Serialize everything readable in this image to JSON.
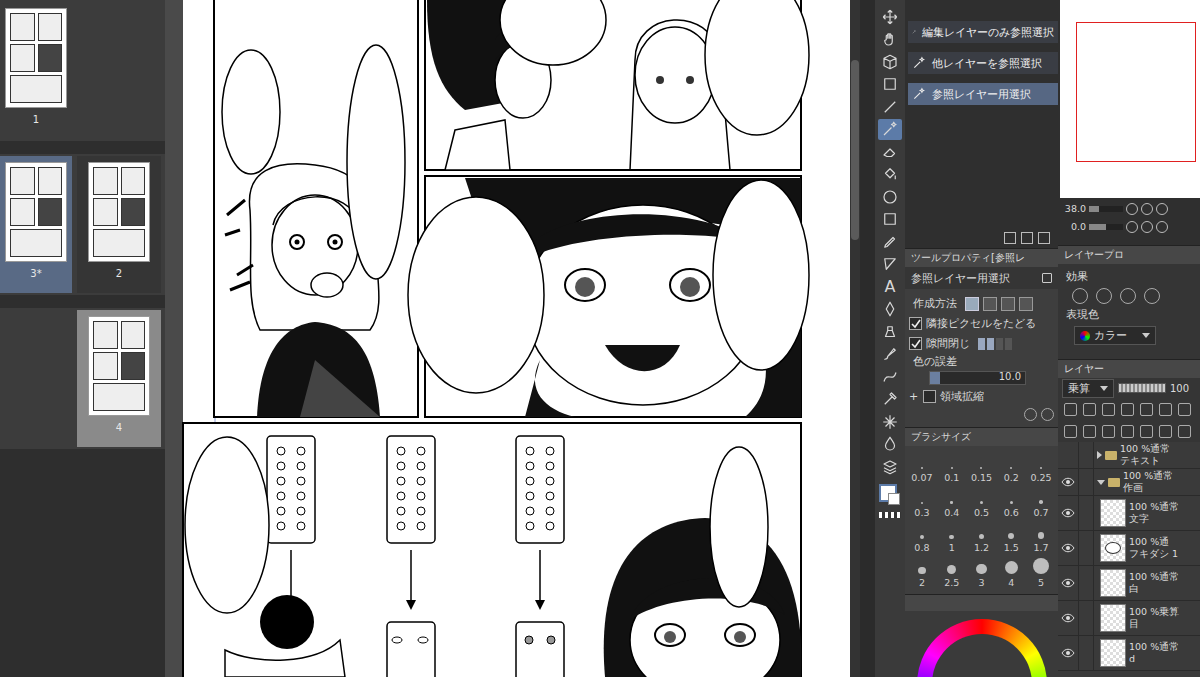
{
  "spreads": [
    {
      "pages": [
        {
          "label": "1",
          "slot": "left",
          "selected": false,
          "highlighted": false
        }
      ]
    },
    {
      "pages": [
        {
          "label": "3*",
          "slot": "left",
          "selected": true,
          "highlighted": false
        },
        {
          "label": "2",
          "slot": "right",
          "selected": false,
          "highlighted": false
        }
      ]
    },
    {
      "pages": [
        {
          "label": "4",
          "slot": "right",
          "selected": false,
          "highlighted": true
        }
      ]
    }
  ],
  "toolbar": [
    {
      "selected": false
    },
    {
      "selected": false
    },
    {
      "selected": false
    },
    {
      "selected": false
    },
    {
      "selected": false
    },
    {
      "selected": true
    },
    {
      "selected": false
    },
    {
      "selected": false
    },
    {
      "selected": false
    },
    {
      "selected": false
    },
    {
      "selected": false
    },
    {
      "selected": false
    },
    {
      "selected": false,
      "glyph": "A"
    },
    {
      "selected": false
    },
    {
      "selected": false
    },
    {
      "selected": false
    },
    {
      "selected": false
    },
    {
      "selected": false
    },
    {
      "selected": false
    },
    {
      "selected": false
    },
    {
      "selected": false
    }
  ],
  "subtools": [
    {
      "label": "編集レイヤーのみ参照選択",
      "selected": false
    },
    {
      "label": "他レイヤーを参照選択",
      "selected": false
    },
    {
      "label": "参照レイヤー用選択",
      "selected": true
    }
  ],
  "tool_property": {
    "title": "ツールプロパティ[参照レ",
    "name": "参照レイヤー用選択",
    "method_label": "作成方法",
    "methods": [
      {
        "selected": true
      },
      {
        "selected": false
      },
      {
        "selected": false
      },
      {
        "selected": false
      }
    ],
    "options": [
      {
        "label": "隣接ピクセルをたどる",
        "checked": true,
        "kind": "check"
      },
      {
        "label": "隙間閉じ",
        "checked": true,
        "kind": "gap",
        "level": 0.5
      }
    ],
    "tolerance_label": "色の誤差",
    "tolerance_value": "10.0",
    "tolerance_level": 0.1,
    "expand_label": "領域拡縮",
    "expand_checked": false
  },
  "brush_size": {
    "title": "ブラシサイズ",
    "sizes": [
      "0.07",
      "0.1",
      "0.15",
      "0.2",
      "0.25",
      "0.3",
      "0.4",
      "0.5",
      "0.6",
      "0.7",
      "0.8",
      "1",
      "1.2",
      "1.5",
      "1.7",
      "2",
      "2.5",
      "3",
      "4",
      "5"
    ]
  },
  "navigator": {
    "zoom": "38.0",
    "zoom_level": 0.3,
    "angle": "0.0",
    "angle_level": 0.5
  },
  "layer_property": {
    "tab": "レイヤープロ",
    "effect_label": "効果",
    "color_label": "表現色",
    "color_value": "カラー"
  },
  "layers_panel": {
    "tab": "レイヤー",
    "blend": "乗算",
    "opacity": "100",
    "opacity_level": 1.0,
    "layers": [
      {
        "mode": "100 %通常",
        "name": "テキスト",
        "kind": "folder",
        "visible": false,
        "expanded": false,
        "children": []
      },
      {
        "mode": "100 %通常",
        "name": "作画",
        "kind": "folder",
        "visible": true,
        "expanded": true,
        "children": [
          {
            "mode": "100 %通常",
            "name": "文字",
            "kind": "raster",
            "visible": true
          },
          {
            "mode": "100 %通",
            "name": "フキダシ 1",
            "kind": "balloon",
            "visible": true
          },
          {
            "mode": "100 %通常",
            "name": "白",
            "kind": "raster",
            "visible": true
          },
          {
            "mode": "100 %乗算",
            "name": "目",
            "kind": "raster",
            "visible": true
          },
          {
            "mode": "100 %通常",
            "name": "d",
            "kind": "raster",
            "visible": true
          }
        ]
      }
    ]
  }
}
